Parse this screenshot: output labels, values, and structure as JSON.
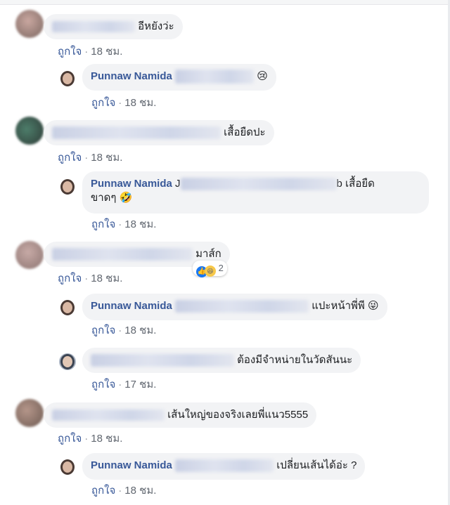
{
  "like_label": "ถูกใจ",
  "comments": [
    {
      "text": "อีหยังว่ะ",
      "time": "18 ชม."
    },
    {
      "name": "Punnaw Namida",
      "text": "",
      "emoji": "😢",
      "time": "18 ชม."
    },
    {
      "text": "เสื้อยืดปะ",
      "time": "18 ชม."
    },
    {
      "name": "Punnaw Namida",
      "text_line1_prefix": "J",
      "text_line1_suffix": "b เสื้อยืด",
      "text_line2": "ขาดๆ",
      "emoji": "🤣",
      "time": "18 ชม."
    },
    {
      "text": "มาส์ก",
      "time": "18 ชม.",
      "reaction_count": "2"
    },
    {
      "name": "Punnaw Namida",
      "text": "แปะหน้าพี่พี",
      "emoji": "😜",
      "time": "18 ชม."
    },
    {
      "text": "ต้องมีจำหน่ายในวัดสันนะ",
      "time": "17 ชม."
    },
    {
      "text": "เส้นใหญ่ของจริงเลยพี่แนว5555",
      "time": "18 ชม."
    },
    {
      "name": "Punnaw Namida",
      "text": "เปลี่ยนเส้นได้อ่ะ ?",
      "time": "18 ชม."
    }
  ],
  "colors": {
    "name": "#385898",
    "bubble": "#f2f3f5",
    "meta": "#616770"
  }
}
